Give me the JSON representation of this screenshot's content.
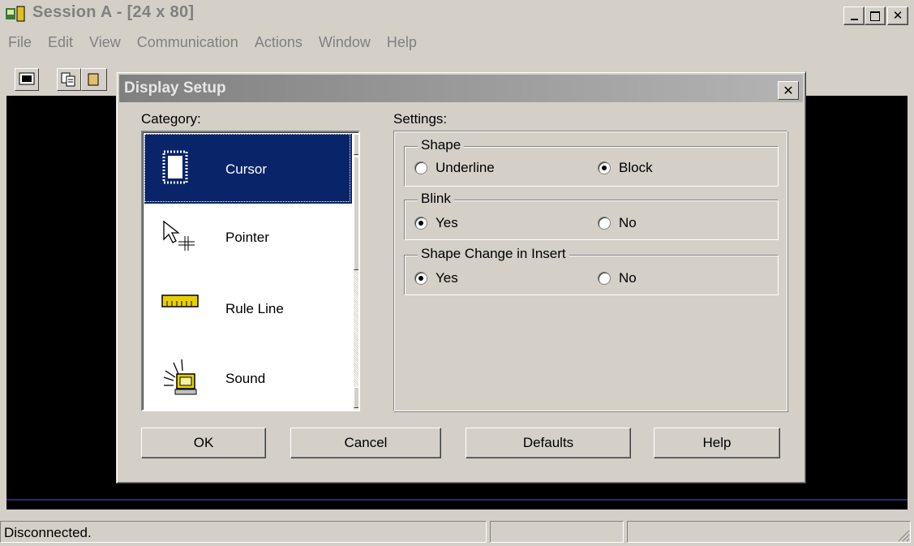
{
  "window": {
    "title": "Session A - [24 x 80]",
    "minimize_icon": "minimize-icon",
    "maximize_icon": "maximize-icon",
    "close_icon": "close-icon",
    "close_glyph": "✕"
  },
  "menu": {
    "items": [
      "File",
      "Edit",
      "View",
      "Communication",
      "Actions",
      "Window",
      "Help"
    ]
  },
  "status": {
    "connection": "Disconnected."
  },
  "dialog": {
    "title": "Display Setup",
    "close_glyph": "✕",
    "category_label": "Category:",
    "settings_label": "Settings:",
    "categories": [
      {
        "label": "Cursor",
        "icon": "cursor-icon",
        "selected": true
      },
      {
        "label": "Pointer",
        "icon": "pointer-icon",
        "selected": false
      },
      {
        "label": "Rule Line",
        "icon": "ruler-icon",
        "selected": false
      },
      {
        "label": "Sound",
        "icon": "sound-icon",
        "selected": false
      }
    ],
    "groups": {
      "shape": {
        "label": "Shape",
        "options": [
          {
            "label": "Underline",
            "checked": false
          },
          {
            "label": "Block",
            "checked": true
          }
        ]
      },
      "blink": {
        "label": "Blink",
        "options": [
          {
            "label": "Yes",
            "checked": true
          },
          {
            "label": "No",
            "checked": false
          }
        ]
      },
      "shape_change": {
        "label": "Shape Change in Insert",
        "options": [
          {
            "label": "Yes",
            "checked": true
          },
          {
            "label": "No",
            "checked": false
          }
        ]
      }
    },
    "buttons": {
      "ok": "OK",
      "cancel": "Cancel",
      "defaults": "Defaults",
      "help": "Help"
    }
  },
  "colors": {
    "selection": "#0a246a",
    "terminal_bg": "#000000",
    "face": "#d4d0c8"
  }
}
